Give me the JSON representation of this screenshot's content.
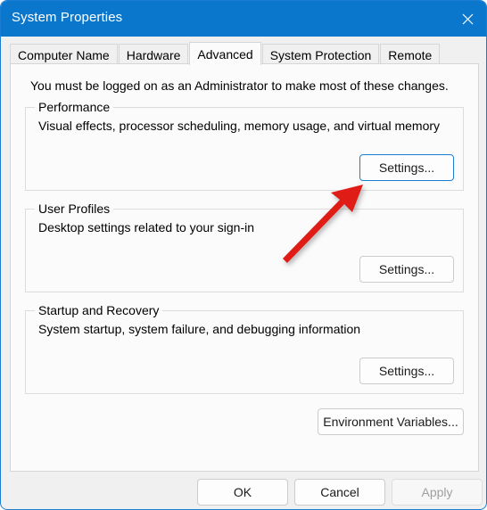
{
  "window": {
    "title": "System Properties",
    "close_icon": "close-icon",
    "titlebar_color": "#0a77cd",
    "border_color": "#1a7fd4"
  },
  "tabs": [
    {
      "label": "Computer Name",
      "selected": false
    },
    {
      "label": "Hardware",
      "selected": false
    },
    {
      "label": "Advanced",
      "selected": true
    },
    {
      "label": "System Protection",
      "selected": false
    },
    {
      "label": "Remote",
      "selected": false
    }
  ],
  "panel": {
    "admin_note": "You must be logged on as an Administrator to make most of these changes.",
    "groups": [
      {
        "title": "Performance",
        "description": "Visual effects, processor scheduling, memory usage, and virtual memory",
        "button_label": "Settings...",
        "focused": true
      },
      {
        "title": "User Profiles",
        "description": "Desktop settings related to your sign-in",
        "button_label": "Settings...",
        "focused": false
      },
      {
        "title": "Startup and Recovery",
        "description": "System startup, system failure, and debugging information",
        "button_label": "Settings...",
        "focused": false
      }
    ],
    "environment_variables_label": "Environment Variables..."
  },
  "footer": {
    "ok_label": "OK",
    "cancel_label": "Cancel",
    "apply_label": "Apply",
    "apply_disabled": true
  },
  "annotation": {
    "arrow_color": "#e01b14",
    "points_at": "Performance Settings..."
  }
}
